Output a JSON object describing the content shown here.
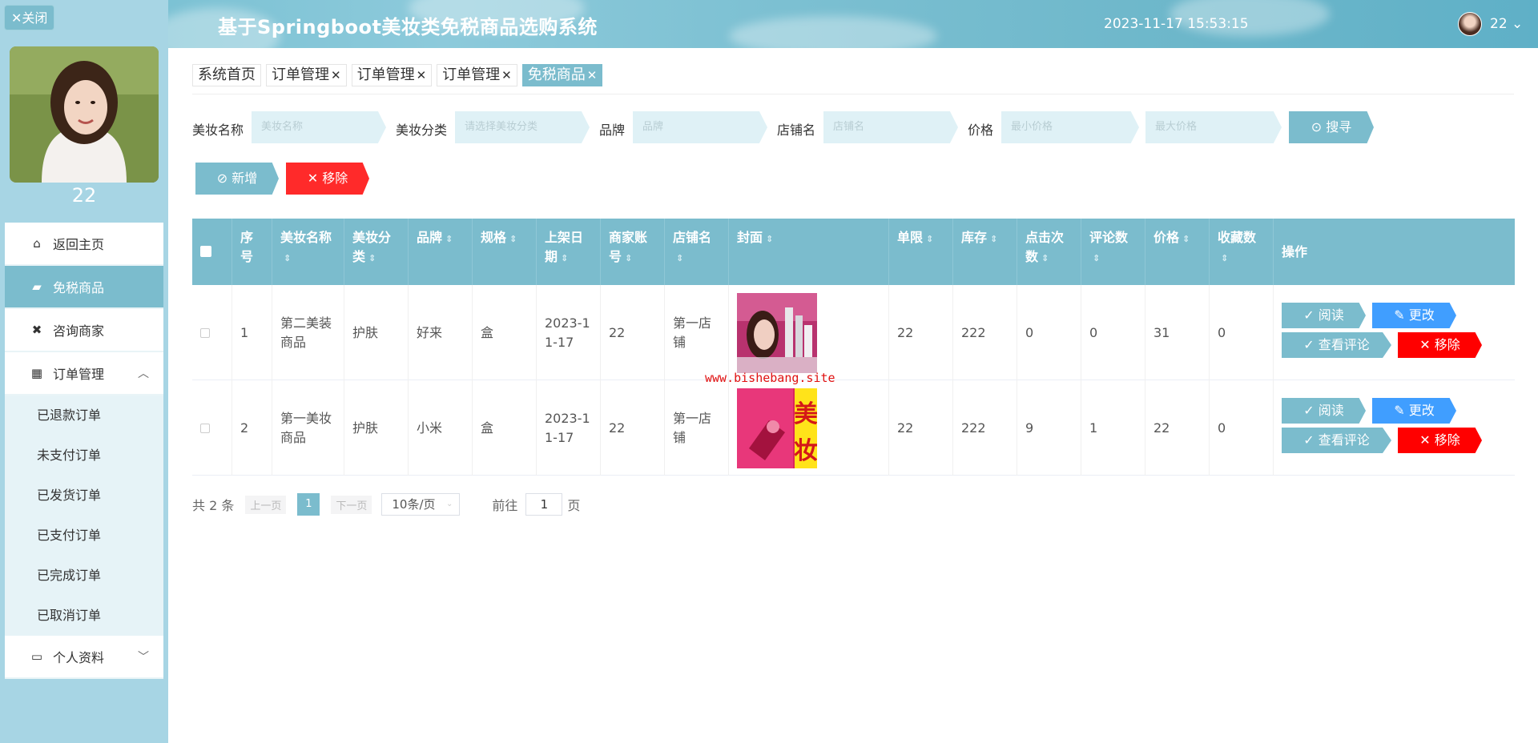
{
  "sidebar": {
    "close_label": "✕关闭",
    "username": "22",
    "menu": [
      {
        "label": "返回主页",
        "icon": "home-icon"
      },
      {
        "label": "免税商品",
        "icon": "bag-icon"
      },
      {
        "label": "咨询商家",
        "icon": "chat-icon"
      },
      {
        "label": "订单管理",
        "icon": "grid-icon"
      }
    ],
    "order_submenu": [
      "已退款订单",
      "未支付订单",
      "已发货订单",
      "已支付订单",
      "已完成订单",
      "已取消订单"
    ],
    "profile_label": "个人资料"
  },
  "header": {
    "title": "基于Springboot美妆类免税商品选购系统",
    "datetime": "2023-11-17 15:53:15",
    "user": "22 ⌄"
  },
  "tabs": [
    {
      "label": "系统首页",
      "closable": false
    },
    {
      "label": "订单管理",
      "closable": true
    },
    {
      "label": "订单管理",
      "closable": true
    },
    {
      "label": "订单管理",
      "closable": true
    },
    {
      "label": "免税商品",
      "closable": true,
      "active": true
    }
  ],
  "search": {
    "name_label": "美妆名称",
    "name_placeholder": "美妆名称",
    "category_label": "美妆分类",
    "category_placeholder": "请选择美妆分类",
    "brand_label": "品牌",
    "brand_placeholder": "品牌",
    "shop_label": "店铺名",
    "shop_placeholder": "店铺名",
    "price_label": "价格",
    "price_min_placeholder": "最小价格",
    "price_max_placeholder": "最大价格",
    "search_button": "搜寻"
  },
  "actions": {
    "add": "新增",
    "remove": "移除"
  },
  "table": {
    "columns": [
      "序号",
      "美妆名称",
      "美妆分类",
      "品牌",
      "规格",
      "上架日期",
      "商家账号",
      "店铺名",
      "封面",
      "单限",
      "库存",
      "点击次数",
      "评论数",
      "价格",
      "收藏数",
      "操作"
    ],
    "rows": [
      {
        "index": "1",
        "name": "第二美装商品",
        "category": "护肤",
        "brand": "好来",
        "spec": "盒",
        "date": "2023-11-17",
        "merchant": "22",
        "shop": "第一店铺",
        "limit": "22",
        "stock": "222",
        "clicks": "0",
        "comments": "0",
        "price": "31",
        "favorites": "0"
      },
      {
        "index": "2",
        "name": "第一美妆商品",
        "category": "护肤",
        "brand": "小米",
        "spec": "盒",
        "date": "2023-11-17",
        "merchant": "22",
        "shop": "第一店铺",
        "limit": "22",
        "stock": "222",
        "clicks": "9",
        "comments": "1",
        "price": "22",
        "favorites": "0"
      }
    ],
    "row_actions": {
      "read": "阅读",
      "edit": "更改",
      "comments": "查看评论",
      "remove": "移除"
    }
  },
  "cover_text": "美妆",
  "watermark": "www.bishebang.site",
  "pagination": {
    "total": "共 2 条",
    "prev": "上一页",
    "page": "1",
    "next": "下一页",
    "size": "10条/页",
    "goto": "前往",
    "goto_value": "1",
    "unit": "页"
  }
}
